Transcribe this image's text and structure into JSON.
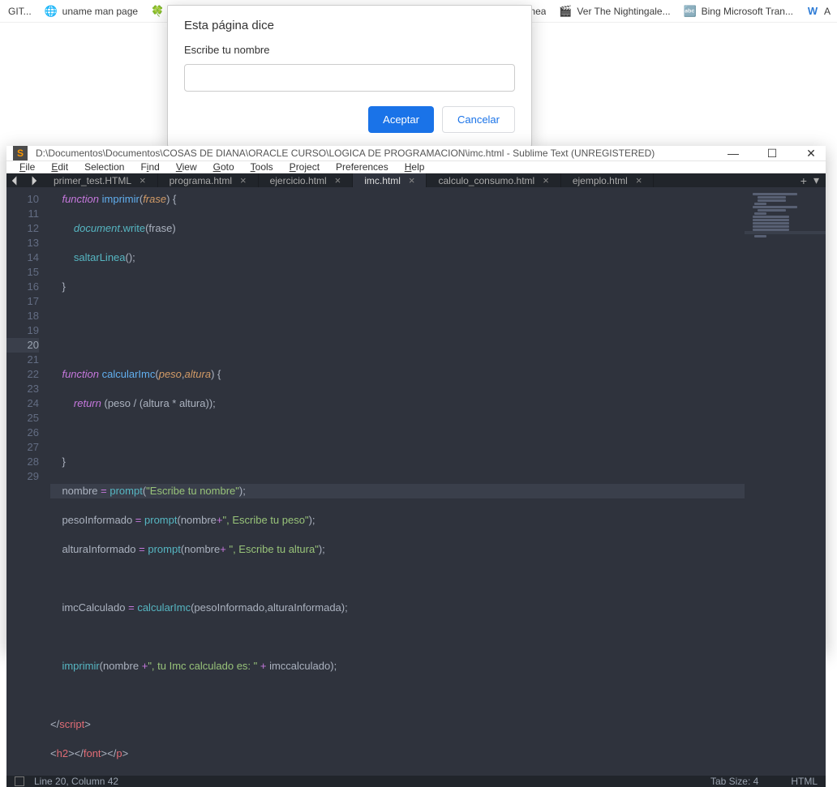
{
  "bookmarks": {
    "b1": "GIT...",
    "b2": "uname man page",
    "b3": "línea",
    "b4": "Ver The Nightingale...",
    "b5": "Bing Microsoft Tran...",
    "b6": "A"
  },
  "dialog": {
    "title": "Esta página dice",
    "message": "Escribe tu nombre",
    "accept": "Aceptar",
    "cancel": "Cancelar",
    "value": ""
  },
  "sublime": {
    "title": "D:\\Documentos\\Documentos\\COSAS DE DIANA\\ORACLE CURSO\\LOGICA DE PROGRAMACION\\imc.html - Sublime Text (UNREGISTERED)",
    "menu": {
      "file": "File",
      "edit": "Edit",
      "selection": "Selection",
      "find": "Find",
      "view": "View",
      "goto": "Goto",
      "tools": "Tools",
      "project": "Project",
      "preferences": "Preferences",
      "help": "Help"
    },
    "tabs": {
      "t1": "primer_test.HTML",
      "t2": "programa.html",
      "t3": "ejercicio.html",
      "t4": "imc.html",
      "t5": "calculo_consumo.html",
      "t6": "ejemplo.html"
    },
    "line_numbers": [
      "10",
      "11",
      "12",
      "13",
      "14",
      "15",
      "16",
      "17",
      "18",
      "19",
      "20",
      "21",
      "22",
      "23",
      "24",
      "25",
      "26",
      "27",
      "28",
      "29"
    ],
    "highlight_line": "20",
    "code": {
      "l10": {
        "kw": "function",
        "name": "imprimir",
        "p": "frase",
        "brace": ") {"
      },
      "l11": {
        "obj": "document",
        "m": "write",
        "arg": "frase",
        "end": ")"
      },
      "l12": {
        "fn": "saltarLinea",
        "p": "();"
      },
      "l13": "}",
      "l16": {
        "kw": "function",
        "name": "calcularImc",
        "p1": "peso",
        "p2": "altura",
        "end": ") {"
      },
      "l17": {
        "kw": "return",
        "expr": " (peso / (altura * altura));"
      },
      "l19": "}",
      "l20": {
        "v": "nombre",
        "eq": " = ",
        "fn": "prompt",
        "s": "\"Escribe tu nombre\"",
        "end": ");"
      },
      "l21": {
        "v": "pesoInformado",
        "eq": " = ",
        "fn": "prompt",
        "a": "nombre",
        "op": "+",
        "s": "\", Escribe tu peso\"",
        "end": ");"
      },
      "l22": {
        "v": "alturaInformado",
        "eq": " = ",
        "fn": "prompt",
        "a": "nombre",
        "op": "+ ",
        "s": "\", Escribe tu altura\"",
        "end": ");"
      },
      "l24": {
        "v": "imcCalculado",
        "eq": " = ",
        "fn": "calcularImc",
        "a": "(pesoInformado,alturaInformada);"
      },
      "l26": {
        "fn": "imprimir",
        "a1": "nombre ",
        "op": "+",
        "s": "\", tu Imc calculado es: \"",
        "op2": " + ",
        "a2": "imccalculado);"
      },
      "l28": {
        "open": "</",
        "tag": "script",
        "close": ">"
      },
      "l29": {
        "o1": "<",
        "t1": "h2",
        "c1": "></",
        "t2": "font",
        "c2": "></",
        "t3": "p",
        "c3": ">"
      }
    },
    "status": {
      "pos": "Line 20, Column 42",
      "tab": "Tab Size: 4",
      "lang": "HTML"
    }
  }
}
